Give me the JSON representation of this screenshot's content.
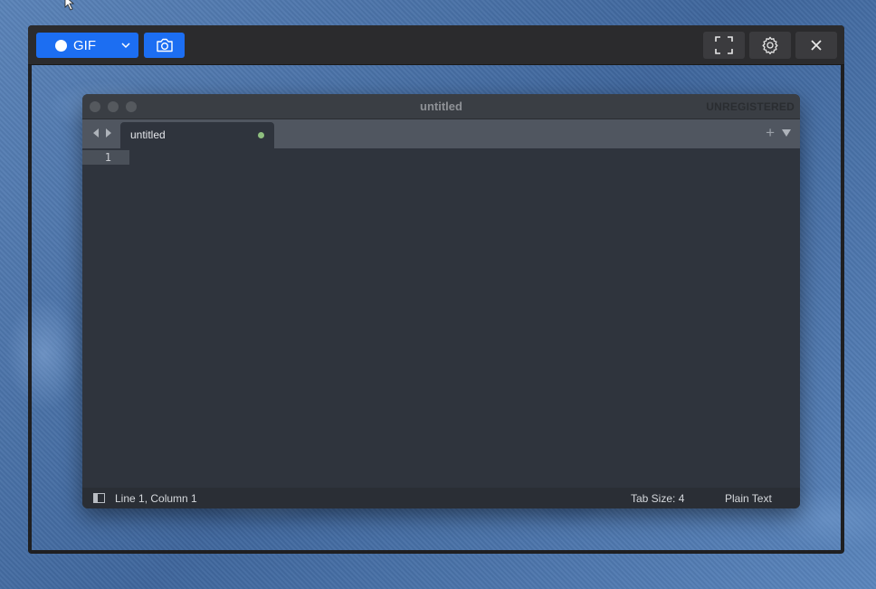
{
  "recorder": {
    "gif_label": "GIF",
    "icons": {
      "record": "record-dot-icon",
      "dropdown": "chevron-down-icon",
      "camera": "camera-icon",
      "fullscreen": "fullscreen-icon",
      "settings": "gear-icon",
      "close": "close-icon"
    },
    "accent": "#1c6ef2"
  },
  "editor": {
    "window_title": "untitled",
    "unregistered_label": "UNREGISTERED",
    "tab": {
      "label": "untitled",
      "modified_color": "#8fbf7f"
    },
    "tab_new_label": "+",
    "line_numbers": [
      "1"
    ],
    "status": {
      "position": "Line 1, Column 1",
      "tab_size": "Tab Size: 4",
      "syntax": "Plain Text"
    }
  }
}
